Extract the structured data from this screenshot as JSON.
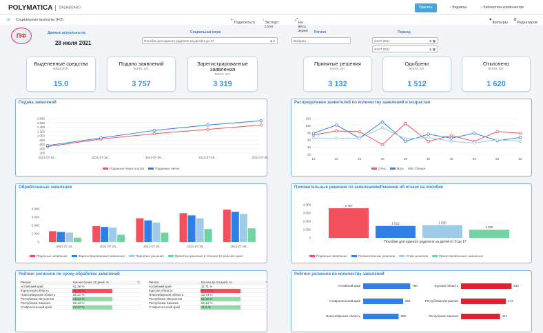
{
  "app": {
    "brand": "POLYMATICA",
    "section": "DASHBOARD",
    "title": "Социальные выплаты (НЗ)"
  },
  "toolbar": {
    "accepted": "Принять",
    "widgets": "Виджеты",
    "library": "Библиотека компонентов",
    "share": "Поделиться",
    "export": "Экспорт слоя",
    "fullscreen": "На весь экран",
    "filters": "Фильтры",
    "edit": "Редактиров"
  },
  "filters": {
    "date_label": "Данные актуальны на",
    "date_value": "28 июля 2021",
    "measure_label": "Социальная мера",
    "measure_value": "Пособие для единого родителя на детей в до 17",
    "region_label": "Регион",
    "region_value": "Выбрать...",
    "period_label": "Период",
    "period_from": "24.07.2021",
    "period_to": "30.07.2021"
  },
  "kpis": [
    {
      "title": "Выделенные средства",
      "unit": "млрд руб.",
      "value": "15.0"
    },
    {
      "title": "Подано заявлений",
      "unit": "всего, шт.",
      "value": "3 757"
    },
    {
      "title": "Зарегистрированные заявления",
      "unit": "всего, шт.",
      "value": "3 319"
    },
    {
      "title": "Принятые решения",
      "unit": "всего, шт.",
      "value": "3 132"
    },
    {
      "title": "Одобрено",
      "unit": "всего, шт.",
      "value": "1 512"
    },
    {
      "title": "Отклонено",
      "unit": "всего, шт.",
      "value": "1 620"
    }
  ],
  "charts": {
    "submissions": {
      "title": "Подача заявлений",
      "legend": [
        "Поданные через портал",
        "Поданные лично"
      ],
      "ticks": [
        "1 800",
        "1 600",
        "1 400",
        "1 200",
        "1 000",
        "800",
        "600",
        "400",
        "200"
      ],
      "x": [
        "2021-07-24...",
        "2021-07-26...",
        "2021-07-28...",
        "2021-07-29...",
        "2021-07-30..."
      ]
    },
    "age_dist": {
      "title": "Распределение заявителей по количеству заявлений и возрастам",
      "legend": [
        "Отец",
        "Мать",
        "Опекун"
      ],
      "ticks": [
        "120",
        "100",
        "80",
        "60",
        "40",
        "20"
      ],
      "x": [
        "15",
        "20",
        "25",
        "30",
        "35",
        "40",
        "45",
        "50",
        "55",
        "60"
      ]
    },
    "processed": {
      "title": "Обработанные заявления",
      "legend": [
        "Поданные заявления",
        "Зарегистрированные заявления",
        "Принятые решения",
        "Принятые решения в течение 10 рабочих дней"
      ],
      "ticks": [
        "4 000",
        "3 000",
        "2 000",
        "1 000",
        "0"
      ],
      "x": [
        "2021-07-24...",
        "2021-07-26...",
        "2021-07-28...",
        "2021-07-29...",
        "2021-07-30..."
      ]
    },
    "decisions": {
      "title": "Положительные решения по заявлениям/Решения об отказе на пособие",
      "legend": [
        "Поданные заявления",
        "Положительные решения",
        "Отказ решения",
        "Приостановленные заявления"
      ],
      "ticks": [
        "4 000",
        "3 000",
        "2 000",
        "1 000",
        "0"
      ],
      "caption": "Пособие для единого родителя на детей от 0 до 17",
      "labels": [
        "3 757",
        "1 512",
        "1 620",
        "1 035"
      ]
    },
    "region_speed": {
      "title": "Рейтинг регионов по сроку обработки заявлений",
      "col1": "Регион",
      "col2": "Кол-во более 10 дней, %",
      "col3": "Кол-во до 10 дней, %"
    },
    "region_count": {
      "title": "Рейтинг регионов по количеству заявлений"
    }
  },
  "table_left": [
    [
      "Алтайский край",
      "82,26 %"
    ],
    [
      "Курганская область",
      "36,16 %"
    ],
    [
      "Новосибирская область",
      "81,21 %"
    ],
    [
      "Республика Ингушетия",
      "48,24 %"
    ],
    [
      "Республика Хакасия",
      "82,13 %"
    ],
    [
      "Ставропольский край",
      "47,27 %"
    ]
  ],
  "table_right": [
    [
      "Алтайский край",
      "11,71 %"
    ],
    [
      "Курская область",
      "37,07 %"
    ],
    [
      "Новосибирская область",
      "22,73 %"
    ],
    [
      "Республика Ингушетия",
      "81,41 %"
    ],
    [
      "Республика Хакасия",
      "82,13 %"
    ],
    [
      "Ставропольский край",
      "41,5 %"
    ]
  ],
  "bars_left": [
    [
      "Алтайский край",
      "780"
    ],
    [
      "Ставропольский край",
      "663"
    ],
    [
      "Новосибирская область",
      "589"
    ]
  ],
  "bars_right": [
    [
      "Курская область",
      "534"
    ],
    [
      "Республика Ингушетия",
      "474"
    ],
    [
      "Республика Хакасия",
      "412"
    ]
  ],
  "chart_data": [
    {
      "type": "line",
      "title": "Подача заявлений",
      "categories": [
        "2021-07-24...",
        "2021-07-26...",
        "2021-07-28...",
        "2021-07-29...",
        "2021-07-30..."
      ],
      "series": [
        {
          "name": "Поданные через портал",
          "values": [
            500,
            850,
            1100,
            1300,
            1500
          ]
        },
        {
          "name": "Поданные лично",
          "values": [
            550,
            900,
            1250,
            1500,
            1700
          ]
        }
      ],
      "ylim": [
        200,
        1800
      ]
    },
    {
      "type": "line",
      "title": "Распределение заявителей по количеству заявлений и возрастам",
      "categories": [
        "15",
        "20",
        "25",
        "30",
        "35",
        "40",
        "45",
        "50",
        "55",
        "60"
      ],
      "series": [
        {
          "name": "Отец",
          "values": [
            80,
            92,
            90,
            50,
            115,
            60,
            78,
            60,
            90,
            85
          ]
        },
        {
          "name": "Мать",
          "values": [
            85,
            110,
            70,
            120,
            60,
            82,
            70,
            85,
            62,
            72
          ]
        },
        {
          "name": "Опекун",
          "values": [
            70,
            70,
            70,
            102,
            68,
            72,
            60,
            55,
            65,
            60
          ]
        }
      ],
      "ylim": [
        20,
        130
      ]
    },
    {
      "type": "bar",
      "title": "Обработанные заявления",
      "categories": [
        "2021-07-24...",
        "2021-07-26...",
        "2021-07-28...",
        "2021-07-29...",
        "2021-07-30..."
      ],
      "series": [
        {
          "name": "Поданные заявления",
          "values": [
            1500,
            2200,
            3300,
            4000,
            4500
          ]
        },
        {
          "name": "Зарегистрированные заявления",
          "values": [
            1400,
            2100,
            3000,
            3700,
            4200
          ]
        },
        {
          "name": "Принятые решения",
          "values": [
            1300,
            2000,
            2700,
            3300,
            3900
          ]
        },
        {
          "name": "Принятые решения в течение 10 рабочих дней",
          "values": [
            600,
            1000,
            1300,
            1800,
            1900
          ]
        }
      ],
      "ylim": [
        0,
        4600
      ]
    },
    {
      "type": "bar",
      "title": "Положительные решения по заявлениям/Решения об отказе на пособие",
      "categories": [
        "Пособие для единого родителя на детей от 0 до 17"
      ],
      "series": [
        {
          "name": "Поданные заявления",
          "values": [
            3757
          ]
        },
        {
          "name": "Положительные решения",
          "values": [
            1512
          ]
        },
        {
          "name": "Отказ решения",
          "values": [
            1620
          ]
        },
        {
          "name": "Приостановленные заявления",
          "values": [
            1035
          ]
        }
      ],
      "ylim": [
        0,
        4200
      ]
    }
  ],
  "colors": {
    "red": "#f2505c",
    "blue": "#2f7fe6",
    "lightblue": "#9fcbe8",
    "green": "#6fd4a0",
    "accent": "#3a8dde"
  }
}
